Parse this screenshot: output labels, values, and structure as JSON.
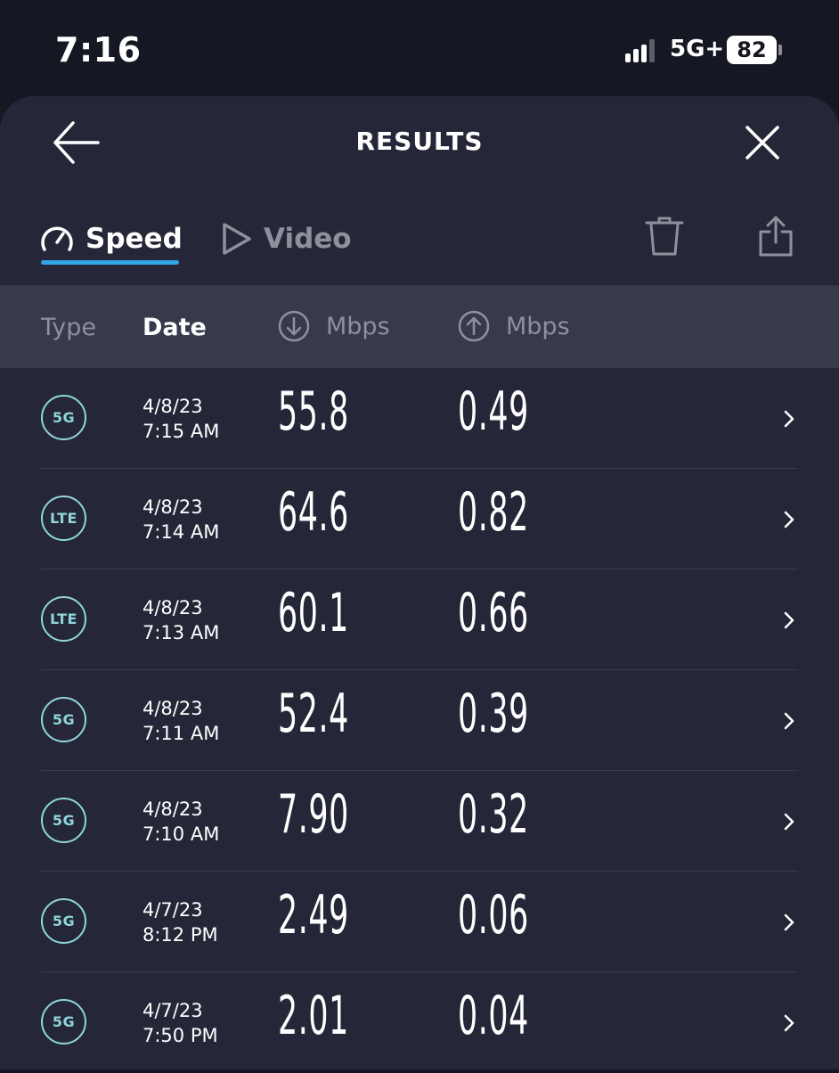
{
  "status_bar": {
    "time": "7:16",
    "network": "5G+",
    "battery": "82"
  },
  "header": {
    "title": "RESULTS"
  },
  "tabs": [
    {
      "label": "Speed",
      "icon": "speedometer-icon",
      "active": true
    },
    {
      "label": "Video",
      "icon": "play-icon",
      "active": false
    }
  ],
  "columns": {
    "type": "Type",
    "date": "Date",
    "download": "Mbps",
    "upload": "Mbps"
  },
  "results": [
    {
      "type": "5G",
      "date": "4/8/23",
      "time": "7:15 AM",
      "download": "55.8",
      "upload": "0.49"
    },
    {
      "type": "LTE",
      "date": "4/8/23",
      "time": "7:14 AM",
      "download": "64.6",
      "upload": "0.82"
    },
    {
      "type": "LTE",
      "date": "4/8/23",
      "time": "7:13 AM",
      "download": "60.1",
      "upload": "0.66"
    },
    {
      "type": "5G",
      "date": "4/8/23",
      "time": "7:11 AM",
      "download": "52.4",
      "upload": "0.39"
    },
    {
      "type": "5G",
      "date": "4/8/23",
      "time": "7:10 AM",
      "download": "7.90",
      "upload": "0.32"
    },
    {
      "type": "5G",
      "date": "4/7/23",
      "time": "8:12 PM",
      "download": "2.49",
      "upload": "0.06"
    },
    {
      "type": "5G",
      "date": "4/7/23",
      "time": "7:50 PM",
      "download": "2.01",
      "upload": "0.04"
    }
  ],
  "colors": {
    "background": "#151823",
    "sheet": "#252738",
    "header_row": "#363a4b",
    "accent": "#2fa6e8",
    "badge": "#8fd6db"
  }
}
